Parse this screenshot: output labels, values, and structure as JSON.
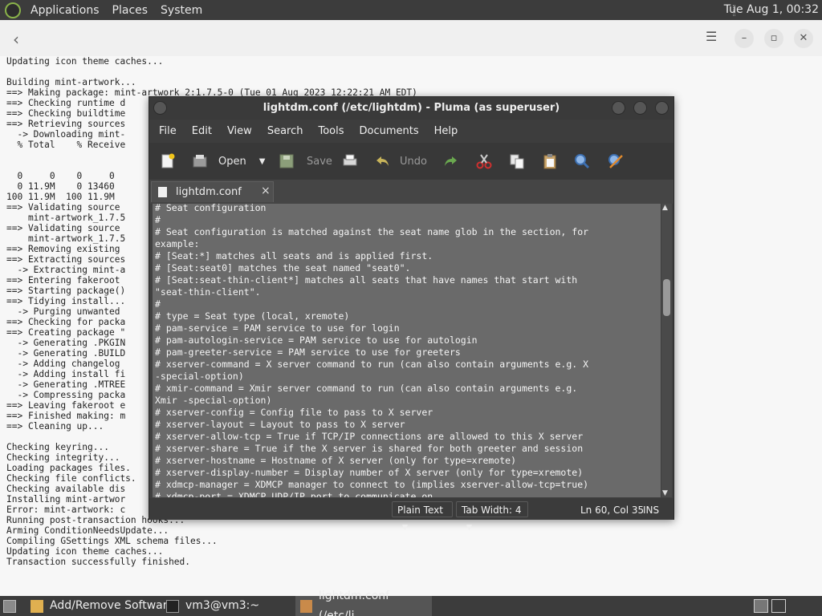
{
  "top_panel": {
    "menus": [
      "Applications",
      "Places",
      "System"
    ],
    "clock": "Tue Aug  1, 00:32"
  },
  "terminal": {
    "back_icon": "back-arrow-icon",
    "lines": [
      "Updating icon theme caches...",
      "",
      "Building mint-artwork...",
      "==> Making package: mint-artwork 2:1.7.5-0 (Tue 01 Aug 2023 12:22:21 AM EDT)",
      "==> Checking runtime d",
      "==> Checking buildtime",
      "==> Retrieving sources",
      "  -> Downloading mint-",
      "  % Total    % Receive",
      "",
      "",
      "  0     0    0     0",
      "  0 11.9M    0 13460",
      "100 11.9M  100 11.9M",
      "==> Validating source",
      "    mint-artwork_1.7.5",
      "==> Validating source",
      "    mint-artwork_1.7.5",
      "==> Removing existing",
      "==> Extracting sources",
      "  -> Extracting mint-a",
      "==> Entering fakeroot",
      "==> Starting package()",
      "==> Tidying install...",
      "  -> Purging unwanted",
      "==> Checking for packa",
      "==> Creating package \"",
      "  -> Generating .PKGIN",
      "  -> Generating .BUILD",
      "  -> Adding changelog",
      "  -> Adding install fi",
      "  -> Generating .MTREE",
      "  -> Compressing packa",
      "==> Leaving fakeroot e",
      "==> Finished making: m",
      "==> Cleaning up...",
      "",
      "Checking keyring...",
      "Checking integrity...",
      "Loading packages files.",
      "Checking file conflicts.",
      "Checking available dis",
      "Installing mint-artwor",
      "Error: mint-artwork: c",
      "Running post-transaction hooks...",
      "Arming ConditionNeedsUpdate...",
      "Compiling GSettings XML schema files...",
      "Updating icon theme caches...",
      "Transaction successfully finished."
    ]
  },
  "editor": {
    "title": "lightdm.conf (/etc/lightdm) - Pluma (as superuser)",
    "menus": [
      "File",
      "Edit",
      "View",
      "Search",
      "Tools",
      "Documents",
      "Help"
    ],
    "toolbar": {
      "open_label": "Open",
      "save_label": "Save",
      "undo_label": "Undo"
    },
    "tab_label": "lightdm.conf",
    "tab_close": "×",
    "code_lines": [
      "# Seat configuration",
      "#",
      "# Seat configuration is matched against the seat name glob in the section, for",
      "example:",
      "# [Seat:*] matches all seats and is applied first.",
      "# [Seat:seat0] matches the seat named \"seat0\".",
      "# [Seat:seat-thin-client*] matches all seats that have names that start with",
      "\"seat-thin-client\".",
      "#",
      "# type = Seat type (local, xremote)",
      "# pam-service = PAM service to use for login",
      "# pam-autologin-service = PAM service to use for autologin",
      "# pam-greeter-service = PAM service to use for greeters",
      "# xserver-command = X server command to run (can also contain arguments e.g. X",
      "-special-option)",
      "# xmir-command = Xmir server command to run (can also contain arguments e.g.",
      "Xmir -special-option)",
      "# xserver-config = Config file to pass to X server",
      "# xserver-layout = Layout to pass to X server",
      "# xserver-allow-tcp = True if TCP/IP connections are allowed to this X server",
      "# xserver-share = True if the X server is shared for both greeter and session",
      "# xserver-hostname = Hostname of X server (only for type=xremote)",
      "# xserver-display-number = Display number of X server (only for type=xremote)",
      "# xdmcp-manager = XDMCP manager to connect to (implies xserver-allow-tcp=true)",
      "# xdmcp-port = XDMCP UDP/IP port to communicate on"
    ],
    "status": {
      "language": "Plain Text",
      "tab_width": "Tab Width:  4",
      "position": "Ln 60, Col 35",
      "mode": "INS"
    }
  },
  "bottom_panel": {
    "tasks": [
      "Add/Remove Software",
      "vm3@vm3:~",
      "lightdm.conf (/etc/li..."
    ]
  },
  "colors": {
    "panel": "#3c3c3c",
    "editor_text_bg": "#6a6a6a",
    "mint_green": "#8ab34a"
  }
}
